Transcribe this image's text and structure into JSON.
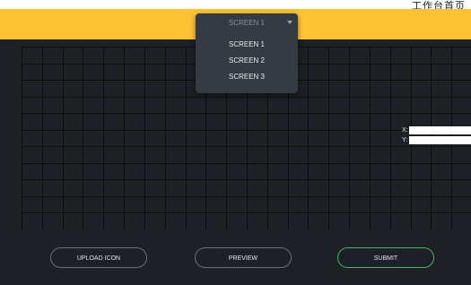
{
  "top_text": "工作台首页",
  "screen_select": {
    "selected": "SCREEN 1",
    "options": [
      "SCREEN 1",
      "SCREEN 2",
      "SCREEN 3"
    ]
  },
  "coords": {
    "x_label": "X:",
    "y_label": "Y:",
    "x_value": "",
    "y_value": ""
  },
  "buttons": {
    "upload": "UPLOAD ICON",
    "preview": "PREVIEW",
    "submit": "SUBMIT"
  },
  "grid": {
    "cols": 22,
    "rows": 11
  },
  "colors": {
    "header": "#ffc333",
    "background": "#1d2024",
    "grid_line": "#0c0d0f",
    "submit_border": "#4caf63"
  }
}
